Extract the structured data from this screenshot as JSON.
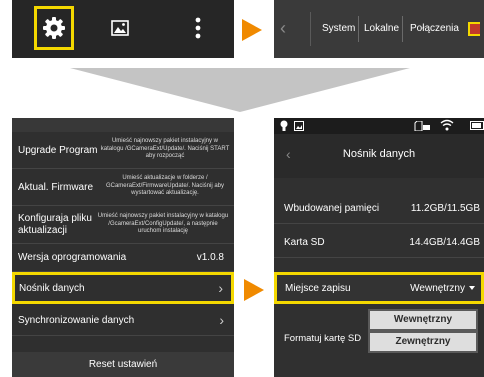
{
  "top_tabs": [
    "System",
    "Lokalne",
    "Połączenia"
  ],
  "settings_list": [
    {
      "title": "Upgrade Program",
      "desc": "Umieść najnowszy pakiet instalacyjny w katalogu /GCameraExt/Update/. Naciśnij START aby rozpocząć"
    },
    {
      "title": "Aktual. Firmware",
      "desc": "Umieść aktualizacje w folderze / GCameraExt/FirmwareUpdate/. Naciśnij aby wystartować aktualizację."
    },
    {
      "title": "Konfiguraja pliku aktualizacji",
      "desc": "Umieść najnowszy pakiet instalacyjny w katalogu /GcameraExt/ConfigUpdate/, a następnie uruchom instalację"
    },
    {
      "title": "Wersja oprogramowania",
      "value": "v1.0.8"
    },
    {
      "title": "Nośnik danych"
    },
    {
      "title": "Synchronizowanie danych"
    }
  ],
  "reset_label": "Reset ustawień",
  "storage_screen": {
    "title": "Nośnik danych",
    "rows": [
      {
        "label": "Wbudowanej pamięci",
        "value": "11.2GB/11.5GB"
      },
      {
        "label": "Karta SD",
        "value": "14.4GB/14.4GB"
      }
    ],
    "save_location": {
      "label": "Miejsce zapisu",
      "value": "Wewnętrzny"
    },
    "format_label": "Formatuj kartę SD",
    "dropdown_options": [
      "Wewnętrzny",
      "Zewnętrzny"
    ]
  },
  "colors": {
    "highlight": "#f4d800",
    "arrow": "#f08a00",
    "panel_bg": "#2f2f2f"
  },
  "icons": [
    "gear-icon",
    "image-icon",
    "more-vertical-icon",
    "bulb-icon",
    "gallery-icon",
    "sd-card-icon",
    "wifi-icon",
    "battery-icon"
  ]
}
